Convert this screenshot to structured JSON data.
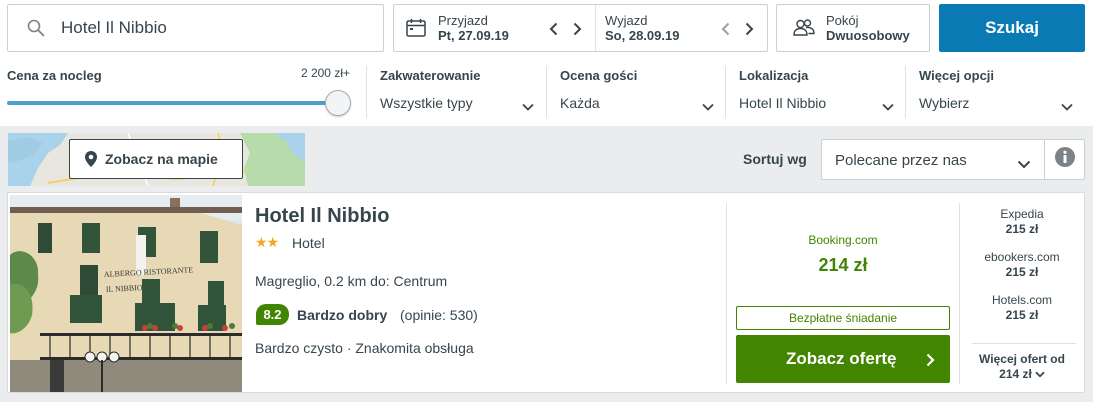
{
  "search": {
    "query": "Hotel Il Nibbio"
  },
  "dates": {
    "checkin_label": "Przyjazd",
    "checkin_value": "Pt, 27.09.19",
    "checkout_label": "Wyjazd",
    "checkout_value": "So, 28.09.19"
  },
  "room": {
    "label": "Pokój",
    "value": "Dwuosobowy"
  },
  "search_button_label": "Szukaj",
  "filters": {
    "price": {
      "label": "Cena za nocleg",
      "max_value": "2 200 zł+",
      "slider_fraction": 1.0
    },
    "accommodation": {
      "label": "Zakwaterowanie",
      "value": "Wszystkie typy"
    },
    "guest_rating": {
      "label": "Ocena gości",
      "value": "Każda"
    },
    "location": {
      "label": "Lokalizacja",
      "value": "Hotel Il Nibbio"
    },
    "more": {
      "label": "Więcej opcji",
      "value": "Wybierz"
    }
  },
  "map": {
    "button_label": "Zobacz na mapie"
  },
  "sort": {
    "label": "Sortuj wg",
    "value": "Polecane przez nas"
  },
  "hotel": {
    "name": "Hotel Il Nibbio",
    "stars": "★★",
    "star_count": 2,
    "type": "Hotel",
    "location": "Magreglio, 0.2 km do: Centrum",
    "rating_score": "8.2",
    "rating_label": "Bardzo dobry",
    "reviews": "(opinie: 530)",
    "features": "Bardzo czysto · Znakomita obsługa",
    "photo_sign_line1": "ALBERGO RISTORANTE",
    "photo_sign_line2": "IL NIBBIO"
  },
  "deal": {
    "provider": "Booking.com",
    "price": "214 zł",
    "badge": "Bezpłatne śniadanie",
    "button_label": "Zobacz ofertę"
  },
  "alt_offers": [
    {
      "provider": "Expedia",
      "price": "215 zł"
    },
    {
      "provider": "ebookers.com",
      "price": "215 zł"
    },
    {
      "provider": "Hotels.com",
      "price": "215 zł"
    }
  ],
  "more_offers": {
    "label": "Więcej ofert od",
    "price": "214 zł"
  },
  "colors": {
    "primary_blue": "#0a7ab5",
    "deal_green": "#428500",
    "star_orange": "#f5a623",
    "slider_blue": "#4d9fd0"
  }
}
